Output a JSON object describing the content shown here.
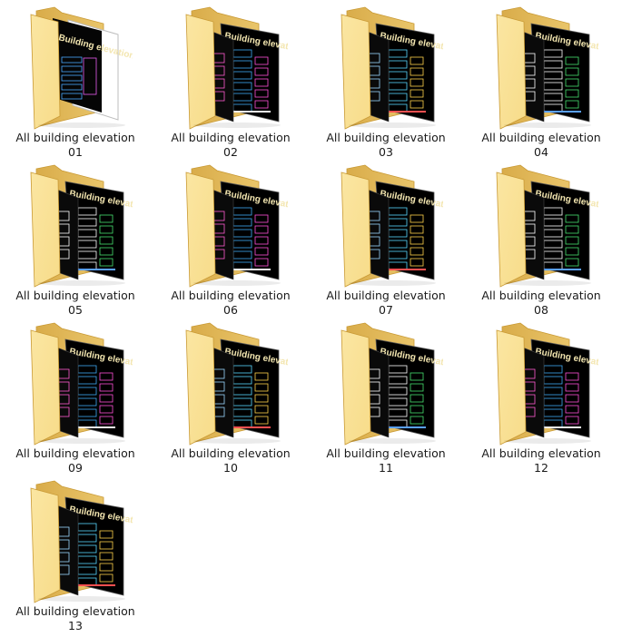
{
  "folders": [
    {
      "line1": "All building elevation",
      "line2": "01",
      "variant": "white"
    },
    {
      "line1": "All building elevation",
      "line2": "02",
      "variant": "a"
    },
    {
      "line1": "All building elevation",
      "line2": "03",
      "variant": "b"
    },
    {
      "line1": "All building elevation",
      "line2": "04",
      "variant": "c"
    },
    {
      "line1": "All building elevation",
      "line2": "05",
      "variant": "c"
    },
    {
      "line1": "All building elevation",
      "line2": "06",
      "variant": "a"
    },
    {
      "line1": "All building elevation",
      "line2": "07",
      "variant": "b"
    },
    {
      "line1": "All building elevation",
      "line2": "08",
      "variant": "c"
    },
    {
      "line1": "All building elevation",
      "line2": "09",
      "variant": "a"
    },
    {
      "line1": "All building elevation",
      "line2": "10",
      "variant": "b"
    },
    {
      "line1": "All building elevation",
      "line2": "11",
      "variant": "c"
    },
    {
      "line1": "All building elevation",
      "line2": "12",
      "variant": "a"
    },
    {
      "line1": "All building elevation",
      "line2": "13",
      "variant": "b"
    }
  ],
  "thumbnail_text": "Building elevation",
  "colors": {
    "folder_back": "#e9c56a",
    "folder_front": "#f7dc8a",
    "folder_edge": "#c99a35",
    "sheet_bg": "#000000",
    "sheet_title": "#f3e6b0"
  }
}
